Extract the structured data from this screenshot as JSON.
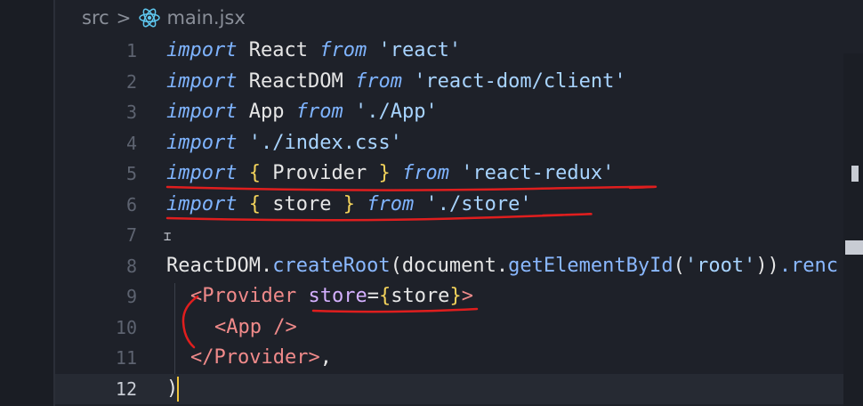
{
  "breadcrumb": {
    "folder": "src",
    "separator": ">",
    "file": "main.jsx",
    "file_icon": "react-icon"
  },
  "colors": {
    "background": "#1e2129",
    "keyword": "#7fb4ff",
    "string": "#a8d4ff",
    "brace": "#f3d35b",
    "tag": "#f08a8a",
    "annotation": "#e01e1e"
  },
  "editor": {
    "active_line": 12,
    "lines": [
      {
        "num": "1"
      },
      {
        "num": "2"
      },
      {
        "num": "3"
      },
      {
        "num": "4"
      },
      {
        "num": "5"
      },
      {
        "num": "6"
      },
      {
        "num": "7"
      },
      {
        "num": "8"
      },
      {
        "num": "9"
      },
      {
        "num": "10"
      },
      {
        "num": "11"
      },
      {
        "num": "12"
      }
    ],
    "tokens": {
      "l1": {
        "kw": "import",
        "id": "React",
        "from": "from",
        "str": "'react'"
      },
      "l2": {
        "kw": "import",
        "id": "ReactDOM",
        "from": "from",
        "str": "'react-dom/client'"
      },
      "l3": {
        "kw": "import",
        "id": "App",
        "from": "from",
        "str": "'./App'"
      },
      "l4": {
        "kw": "import",
        "str": "'./index.css'"
      },
      "l5": {
        "kw": "import",
        "open": "{",
        "id": "Provider",
        "close": "}",
        "from": "from",
        "str": "'react-redux'"
      },
      "l6": {
        "kw": "import",
        "open": "{",
        "id": "store",
        "close": "}",
        "from": "from",
        "str": "'./store'"
      },
      "l8": {
        "obj": "ReactDOM",
        "dot": ".",
        "method": "createRoot",
        "lp": "(",
        "doc": "document",
        "dot2": ".",
        "method2": "getElementById",
        "lp2": "(",
        "str": "'root'",
        "rp2": "))",
        "tail": ".renc"
      },
      "l9": {
        "lt": "<",
        "tag": "Provider",
        "attr": "store",
        "eq": "=",
        "open": "{",
        "val": "store",
        "close": "}",
        "gt": ">"
      },
      "l10": {
        "lt": "<",
        "tag": "App",
        "end": " />"
      },
      "l11": {
        "lt": "</",
        "tag": "Provider",
        "gt": ">",
        "comma": ","
      },
      "l12": {
        "paren": ")"
      }
    }
  }
}
